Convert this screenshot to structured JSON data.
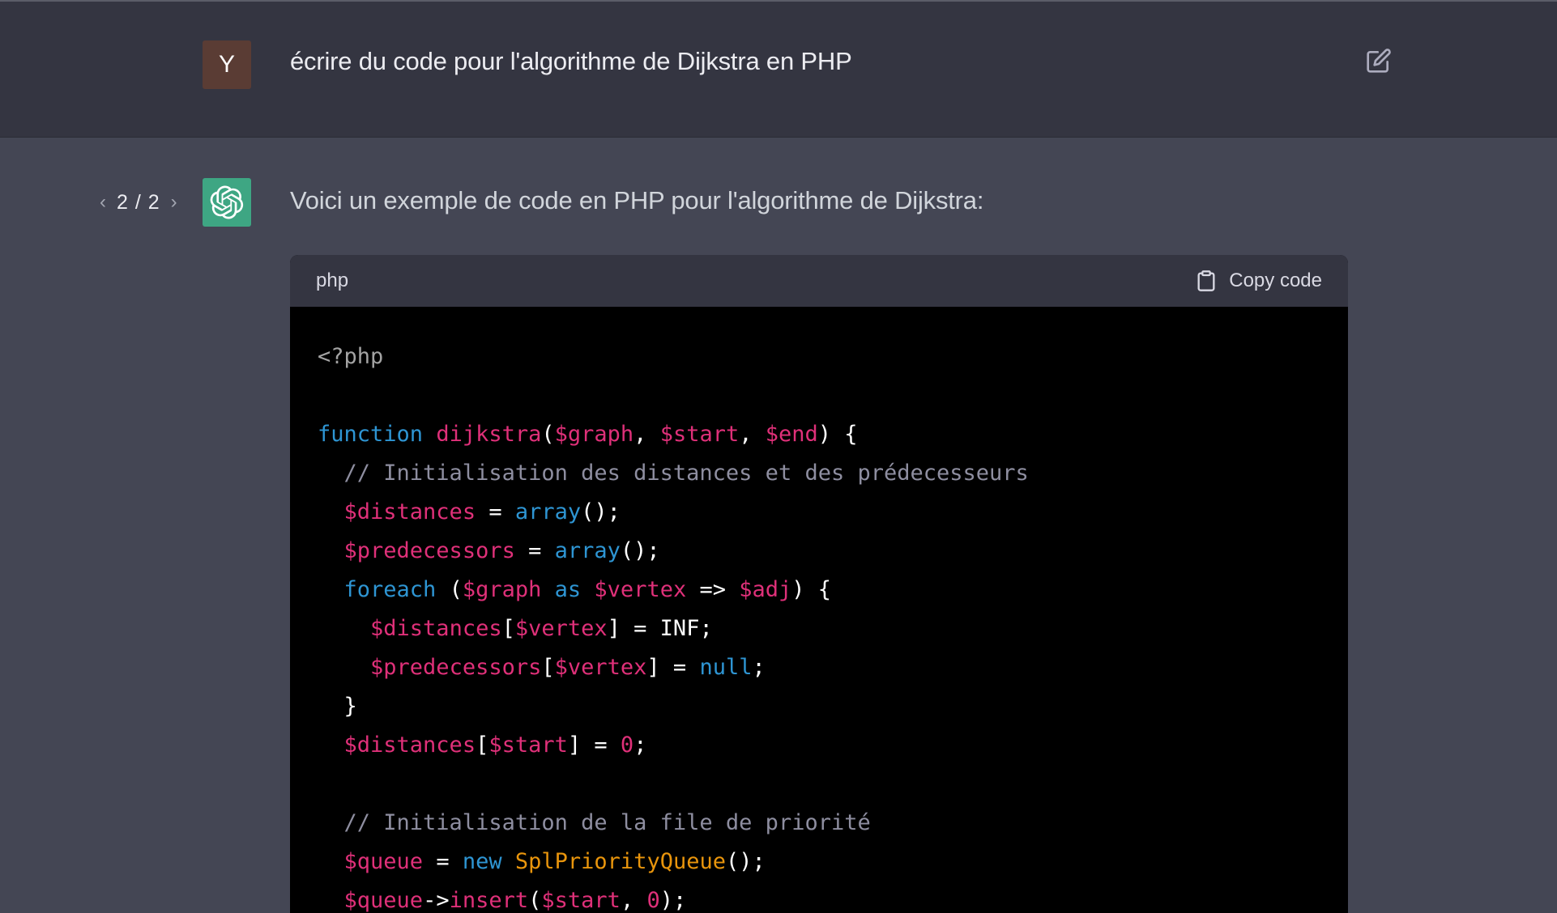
{
  "user_message": {
    "avatar_letter": "Y",
    "text": "écrire du code pour l'algorithme de Dijkstra en PHP",
    "edit_icon": "edit-icon"
  },
  "assistant_message": {
    "pager": {
      "prev_icon": "chevron-left-icon",
      "label": "2 / 2",
      "next_icon": "chevron-right-icon"
    },
    "avatar_icon": "openai-logo-icon",
    "intro": "Voici un exemple de code en PHP pour l'algorithme de Dijkstra:",
    "code_block": {
      "language": "php",
      "copy_label": "Copy code",
      "copy_icon": "clipboard-icon",
      "lines": [
        [
          {
            "t": "<?php",
            "c": "meta"
          }
        ],
        [],
        [
          {
            "t": "function",
            "c": "keyword"
          },
          {
            "t": " ",
            "c": "plain"
          },
          {
            "t": "dijkstra",
            "c": "func"
          },
          {
            "t": "(",
            "c": "plain"
          },
          {
            "t": "$graph",
            "c": "var"
          },
          {
            "t": ", ",
            "c": "plain"
          },
          {
            "t": "$start",
            "c": "var"
          },
          {
            "t": ", ",
            "c": "plain"
          },
          {
            "t": "$end",
            "c": "var"
          },
          {
            "t": ") {",
            "c": "plain"
          }
        ],
        [
          {
            "t": "  // Initialisation des distances et des prédecesseurs",
            "c": "comment"
          }
        ],
        [
          {
            "t": "  ",
            "c": "plain"
          },
          {
            "t": "$distances",
            "c": "var"
          },
          {
            "t": " = ",
            "c": "plain"
          },
          {
            "t": "array",
            "c": "builtin"
          },
          {
            "t": "();",
            "c": "plain"
          }
        ],
        [
          {
            "t": "  ",
            "c": "plain"
          },
          {
            "t": "$predecessors",
            "c": "var"
          },
          {
            "t": " = ",
            "c": "plain"
          },
          {
            "t": "array",
            "c": "builtin"
          },
          {
            "t": "();",
            "c": "plain"
          }
        ],
        [
          {
            "t": "  ",
            "c": "plain"
          },
          {
            "t": "foreach",
            "c": "keyword"
          },
          {
            "t": " (",
            "c": "plain"
          },
          {
            "t": "$graph",
            "c": "var"
          },
          {
            "t": " ",
            "c": "plain"
          },
          {
            "t": "as",
            "c": "keyword"
          },
          {
            "t": " ",
            "c": "plain"
          },
          {
            "t": "$vertex",
            "c": "var"
          },
          {
            "t": " => ",
            "c": "plain"
          },
          {
            "t": "$adj",
            "c": "var"
          },
          {
            "t": ") {",
            "c": "plain"
          }
        ],
        [
          {
            "t": "    ",
            "c": "plain"
          },
          {
            "t": "$distances",
            "c": "var"
          },
          {
            "t": "[",
            "c": "plain"
          },
          {
            "t": "$vertex",
            "c": "var"
          },
          {
            "t": "] = INF;",
            "c": "plain"
          }
        ],
        [
          {
            "t": "    ",
            "c": "plain"
          },
          {
            "t": "$predecessors",
            "c": "var"
          },
          {
            "t": "[",
            "c": "plain"
          },
          {
            "t": "$vertex",
            "c": "var"
          },
          {
            "t": "] = ",
            "c": "plain"
          },
          {
            "t": "null",
            "c": "builtin"
          },
          {
            "t": ";",
            "c": "plain"
          }
        ],
        [
          {
            "t": "  }",
            "c": "plain"
          }
        ],
        [
          {
            "t": "  ",
            "c": "plain"
          },
          {
            "t": "$distances",
            "c": "var"
          },
          {
            "t": "[",
            "c": "plain"
          },
          {
            "t": "$start",
            "c": "var"
          },
          {
            "t": "] = ",
            "c": "plain"
          },
          {
            "t": "0",
            "c": "number"
          },
          {
            "t": ";",
            "c": "plain"
          }
        ],
        [],
        [
          {
            "t": "  // Initialisation de la file de priorité",
            "c": "comment"
          }
        ],
        [
          {
            "t": "  ",
            "c": "plain"
          },
          {
            "t": "$queue",
            "c": "var"
          },
          {
            "t": " = ",
            "c": "plain"
          },
          {
            "t": "new",
            "c": "keyword"
          },
          {
            "t": " ",
            "c": "plain"
          },
          {
            "t": "SplPriorityQueue",
            "c": "class"
          },
          {
            "t": "();",
            "c": "plain"
          }
        ],
        [
          {
            "t": "  ",
            "c": "plain"
          },
          {
            "t": "$queue",
            "c": "var"
          },
          {
            "t": "->",
            "c": "plain"
          },
          {
            "t": "insert",
            "c": "func"
          },
          {
            "t": "(",
            "c": "plain"
          },
          {
            "t": "$start",
            "c": "var"
          },
          {
            "t": ", ",
            "c": "plain"
          },
          {
            "t": "0",
            "c": "number"
          },
          {
            "t": ");",
            "c": "plain"
          }
        ]
      ]
    }
  },
  "colors": {
    "user_bg": "#343541",
    "assistant_bg": "#444654",
    "code_bg": "#000000",
    "user_avatar": "#5a3c34",
    "gpt_avatar": "#3ea683"
  }
}
